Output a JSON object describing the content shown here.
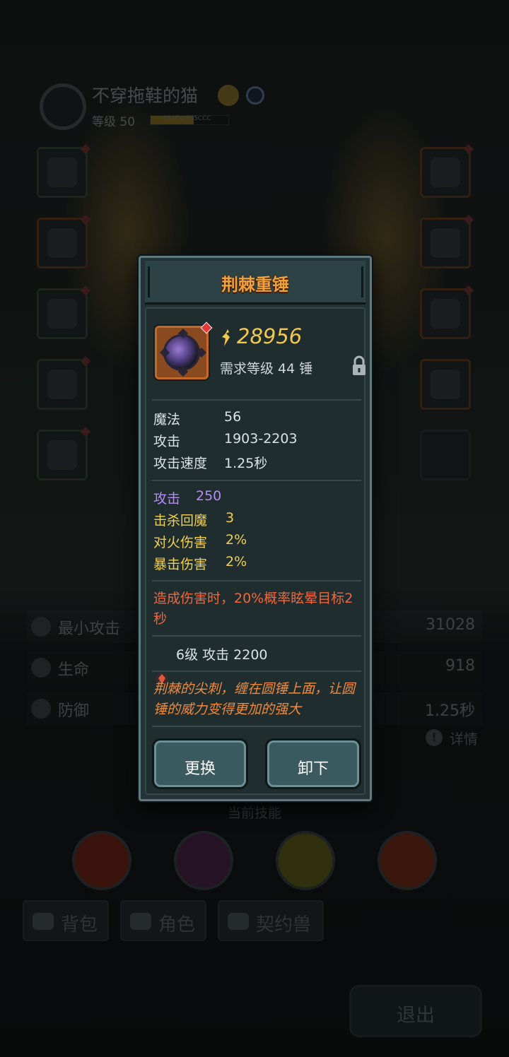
{
  "player": {
    "name": "不穿拖鞋的猫",
    "level_label": "等级 50",
    "exp_text": "883E4/735CCC",
    "exp_fraction": 0.55
  },
  "stats": [
    {
      "label": "最小攻击",
      "value": "31028"
    },
    {
      "label": "生命",
      "value": "918"
    },
    {
      "label": "防御",
      "value": "1.25秒"
    }
  ],
  "details_label": "详情",
  "skills_title": "当前技能",
  "tabs": [
    {
      "label": "背包"
    },
    {
      "label": "角色"
    },
    {
      "label": "契约兽"
    }
  ],
  "exit_label": "退出",
  "item": {
    "name": "荆棘重锤",
    "power": "28956",
    "requirement": "需求等级 44   锤",
    "base_stats": [
      {
        "label": "魔法",
        "value": "56"
      },
      {
        "label": "攻击",
        "value": "1903-2203"
      },
      {
        "label": "攻击速度",
        "value": "1.25秒"
      }
    ],
    "bonus_stats": [
      {
        "label": "攻击",
        "value": "250",
        "color": "#b48cf5"
      },
      {
        "label": "击杀回魔",
        "value": "3",
        "color": "#f0cf52"
      },
      {
        "label": "对火伤害",
        "value": "2%",
        "color": "#f0cf52"
      },
      {
        "label": "暴击伤害",
        "value": "2%",
        "color": "#f0cf52"
      }
    ],
    "special_effect": "造成伤害时，20%概率眩晕目标2秒",
    "gem_line": "6级  攻击 2200",
    "flavor_text": "荆棘的尖刺，缠在圆锤上面，让圆锤的威力变得更加的强大",
    "replace_label": "更换",
    "unequip_label": "卸下"
  },
  "colors": {
    "title": "#f0a23a",
    "power": "#f2c94c",
    "purple_stat": "#b48cf5",
    "yellow_stat": "#f0cf52",
    "special": "#f0673e",
    "flavor": "#f08a3a"
  }
}
